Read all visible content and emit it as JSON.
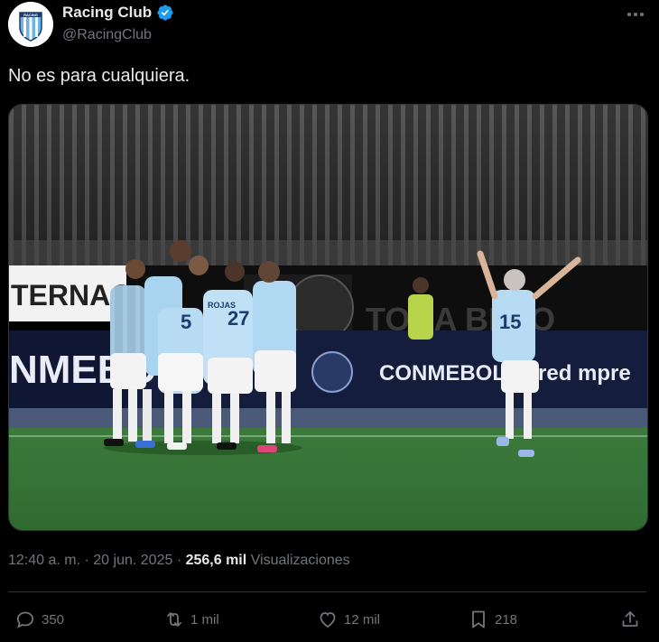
{
  "author": {
    "display_name": "Racing Club",
    "handle": "@RacingClub",
    "avatar_text": "RACING"
  },
  "tweet": {
    "text": "No es para cualquiera."
  },
  "media": {
    "ad_board_left": "TERNACION",
    "ad_board_bottom_left": "NMEBO",
    "ad_board_right": "CONMEBOL Acred    mpre",
    "ad_board_top_right": "TODA    BELO",
    "player_numbers": [
      "5",
      "27",
      "15"
    ],
    "player_name": "ROJAS"
  },
  "meta": {
    "time": "12:40 a. m.",
    "separator1": "·",
    "date": "20 jun. 2025",
    "separator2": "·",
    "views_count": "256,6 mil",
    "views_label": "Visualizaciones"
  },
  "actions": {
    "replies": "350",
    "reposts": "1 mil",
    "likes": "12 mil",
    "bookmarks": "218"
  },
  "colors": {
    "background": "#000000",
    "text": "#e7e9ea",
    "secondary": "#71767b",
    "verified": "#1d9bf0",
    "border": "#2f3336"
  }
}
